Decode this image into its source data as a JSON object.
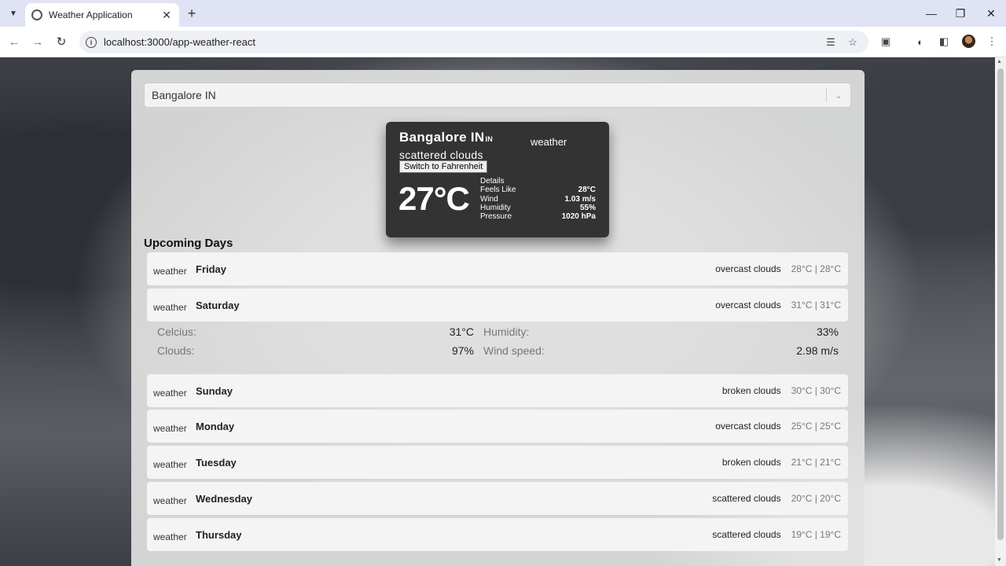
{
  "browser": {
    "tab_title": "Weather Application",
    "url": "localhost:3000/app-weather-react"
  },
  "search": {
    "value": "Bangalore IN"
  },
  "current": {
    "city": "Bangalore IN",
    "country": "IN",
    "description": "scattered clouds",
    "icon_alt": "weather",
    "unit_button": "Switch to Fahrenheit",
    "temperature": "27°C",
    "details": {
      "title": "Details",
      "rows": [
        {
          "label": "Feels Like",
          "value": "28°C"
        },
        {
          "label": "Wind",
          "value": "1.03 m/s"
        },
        {
          "label": "Humidity",
          "value": "55%"
        },
        {
          "label": "Pressure",
          "value": "1020 hPa"
        }
      ]
    }
  },
  "upcoming": {
    "title": "Upcoming Days",
    "days": [
      {
        "icon_alt": "weather",
        "name": "Friday",
        "description": "overcast clouds",
        "temps": "28°C | 28°C"
      },
      {
        "icon_alt": "weather",
        "name": "Saturday",
        "description": "overcast clouds",
        "temps": "31°C | 31°C"
      },
      {
        "icon_alt": "weather",
        "name": "Sunday",
        "description": "broken clouds",
        "temps": "30°C | 30°C"
      },
      {
        "icon_alt": "weather",
        "name": "Monday",
        "description": "overcast clouds",
        "temps": "25°C | 25°C"
      },
      {
        "icon_alt": "weather",
        "name": "Tuesday",
        "description": "broken clouds",
        "temps": "21°C | 21°C"
      },
      {
        "icon_alt": "weather",
        "name": "Wednesday",
        "description": "scattered clouds",
        "temps": "20°C | 20°C"
      },
      {
        "icon_alt": "weather",
        "name": "Thursday",
        "description": "scattered clouds",
        "temps": "19°C | 19°C"
      }
    ],
    "expanded": {
      "celcius_label": "Celcius:",
      "celcius_value": "31°C",
      "humidity_label": "Humidity:",
      "humidity_value": "33%",
      "clouds_label": "Clouds:",
      "clouds_value": "97%",
      "wind_label": "Wind speed:",
      "wind_value": "2.98 m/s"
    }
  }
}
